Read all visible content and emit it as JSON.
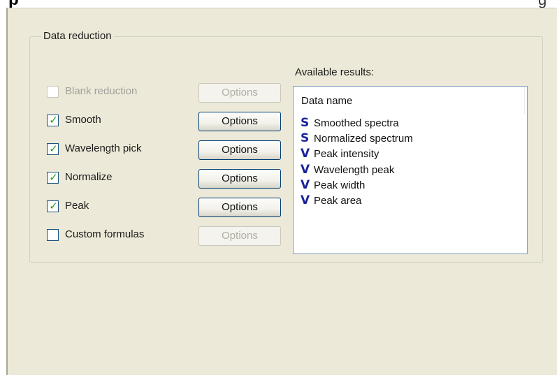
{
  "header": {
    "left_fragment": "p",
    "right_fragment": "g"
  },
  "group": {
    "title": "Data reduction"
  },
  "options_label": "Options",
  "rows": [
    {
      "label": "Blank reduction",
      "checked": false,
      "enabled": false,
      "options_enabled": false
    },
    {
      "label": "Smooth",
      "checked": true,
      "enabled": true,
      "options_enabled": true
    },
    {
      "label": "Wavelength pick",
      "checked": true,
      "enabled": true,
      "options_enabled": true
    },
    {
      "label": "Normalize",
      "checked": true,
      "enabled": true,
      "options_enabled": true
    },
    {
      "label": "Peak",
      "checked": true,
      "enabled": true,
      "options_enabled": true
    },
    {
      "label": "Custom formulas",
      "checked": false,
      "enabled": true,
      "options_enabled": false
    }
  ],
  "available": {
    "label": "Available results:",
    "header": "Data name",
    "items": [
      {
        "icon": "S",
        "name": "Smoothed spectra"
      },
      {
        "icon": "S",
        "name": "Normalized spectrum"
      },
      {
        "icon": "V",
        "name": "Peak intensity"
      },
      {
        "icon": "V",
        "name": "Wavelength peak"
      },
      {
        "icon": "V",
        "name": "Peak width"
      },
      {
        "icon": "V",
        "name": "Peak area"
      }
    ]
  },
  "colors": {
    "panel_bg": "#ece9d8",
    "icon_color": "#1a2399",
    "check_color": "#21a121"
  }
}
